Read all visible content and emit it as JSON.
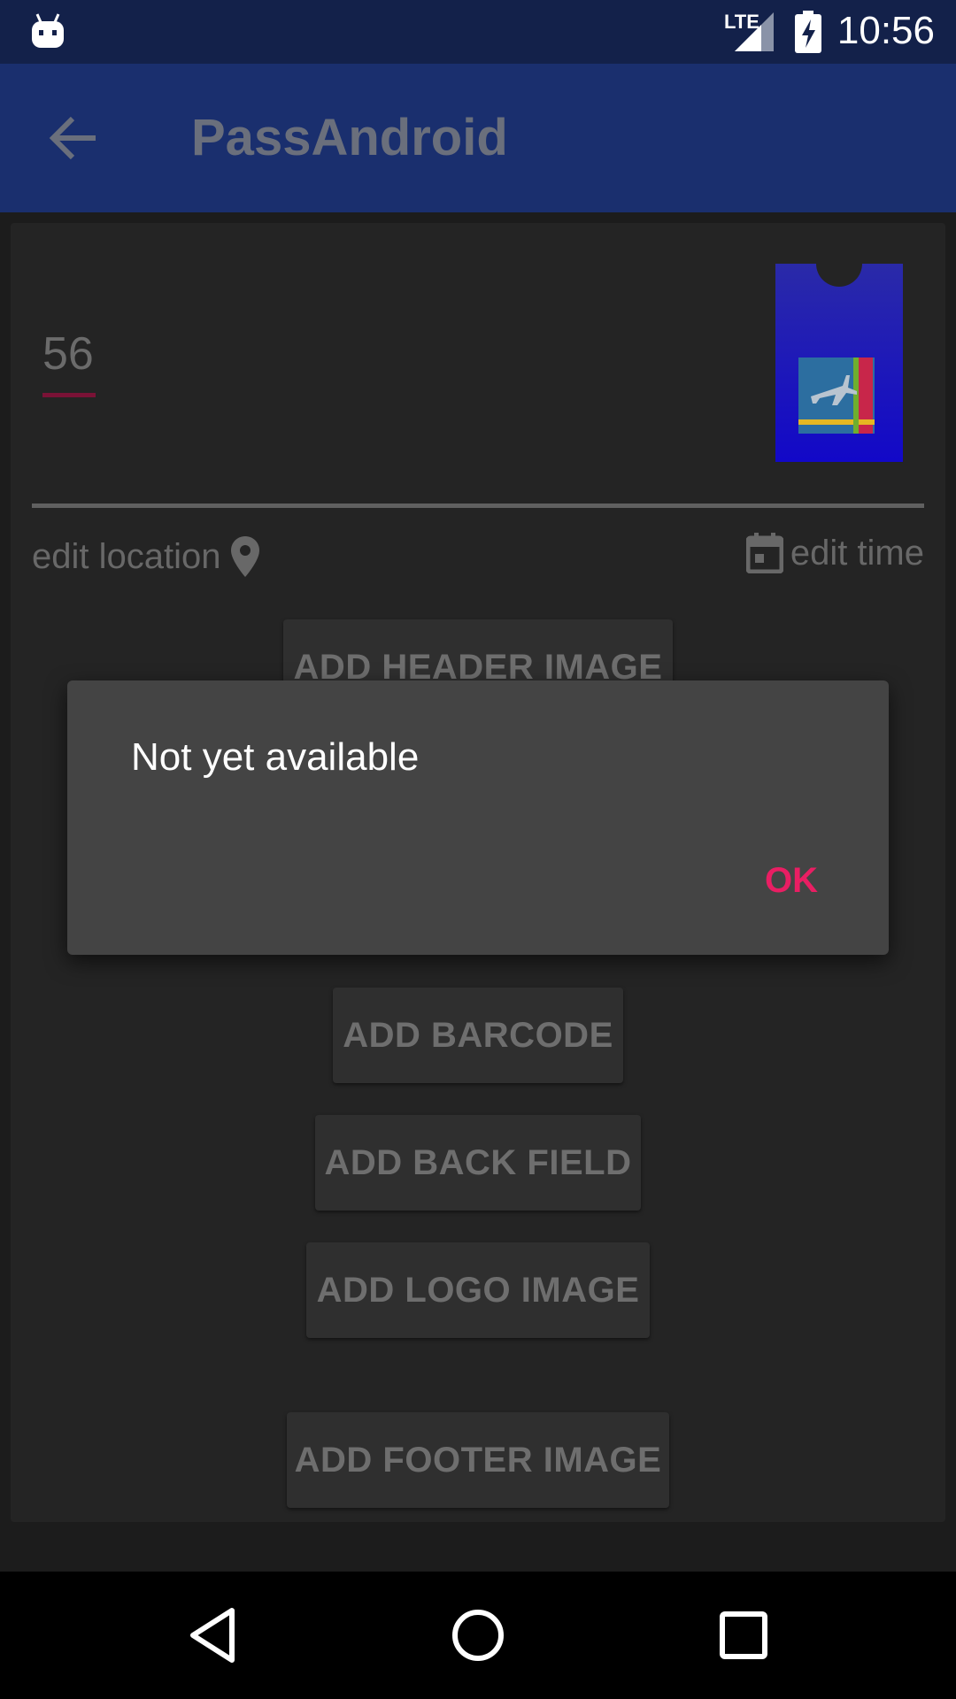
{
  "status_bar": {
    "time": "10:56",
    "network": "LTE",
    "icons": [
      "android-icon",
      "signal-icon",
      "battery-charging-icon"
    ]
  },
  "app_bar": {
    "title": "PassAndroid",
    "back_icon": "arrow-left-icon"
  },
  "pass": {
    "number": "56",
    "edit_location_label": "edit location",
    "edit_time_label": "edit time",
    "icons": [
      "map-pin-icon",
      "calendar-icon",
      "pass-ticket-icon"
    ]
  },
  "buttons": {
    "add_header_image": "ADD HEADER IMAGE",
    "add_barcode": "ADD BARCODE",
    "add_back_field": "ADD BACK FIELD",
    "add_logo_image": "ADD LOGO IMAGE",
    "add_footer_image": "ADD FOOTER IMAGE"
  },
  "dialog": {
    "message": "Not yet available",
    "ok_label": "OK"
  },
  "nav_bar": {
    "icons": [
      "back-triangle-icon",
      "home-circle-icon",
      "recents-square-icon"
    ]
  },
  "colors": {
    "status_bar": "#13214a",
    "app_bar": "#1a2f6e",
    "accent": "#e91e63",
    "dialog_bg": "#444444"
  }
}
